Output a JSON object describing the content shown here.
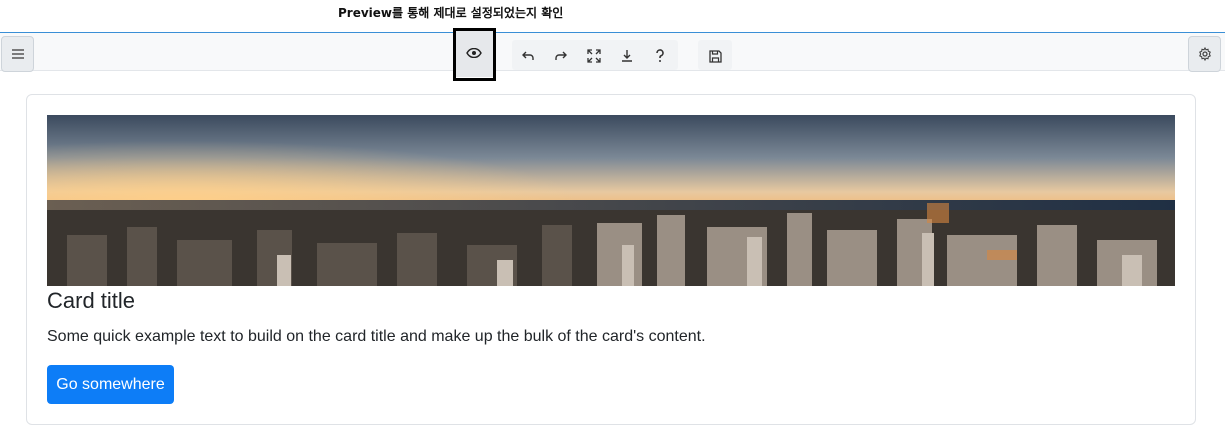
{
  "annotation": {
    "caption": "Preview를 통해 제대로 설정되었는지 확인"
  },
  "toolbar": {
    "left_icon": "menu-icon",
    "center_icons": [
      "eye-icon",
      "undo-icon",
      "redo-icon",
      "fullscreen-icon",
      "download-icon",
      "help-icon",
      "save-icon"
    ],
    "right_icon": "gear-icon",
    "accent": "#3a8fd6"
  },
  "card": {
    "image_alt": "city skyline at sunset",
    "title": "Card title",
    "text": "Some quick example text to build on the card title and make up the bulk of the card's content.",
    "button_label": "Go somewhere",
    "button_color": "#0d7df7"
  }
}
